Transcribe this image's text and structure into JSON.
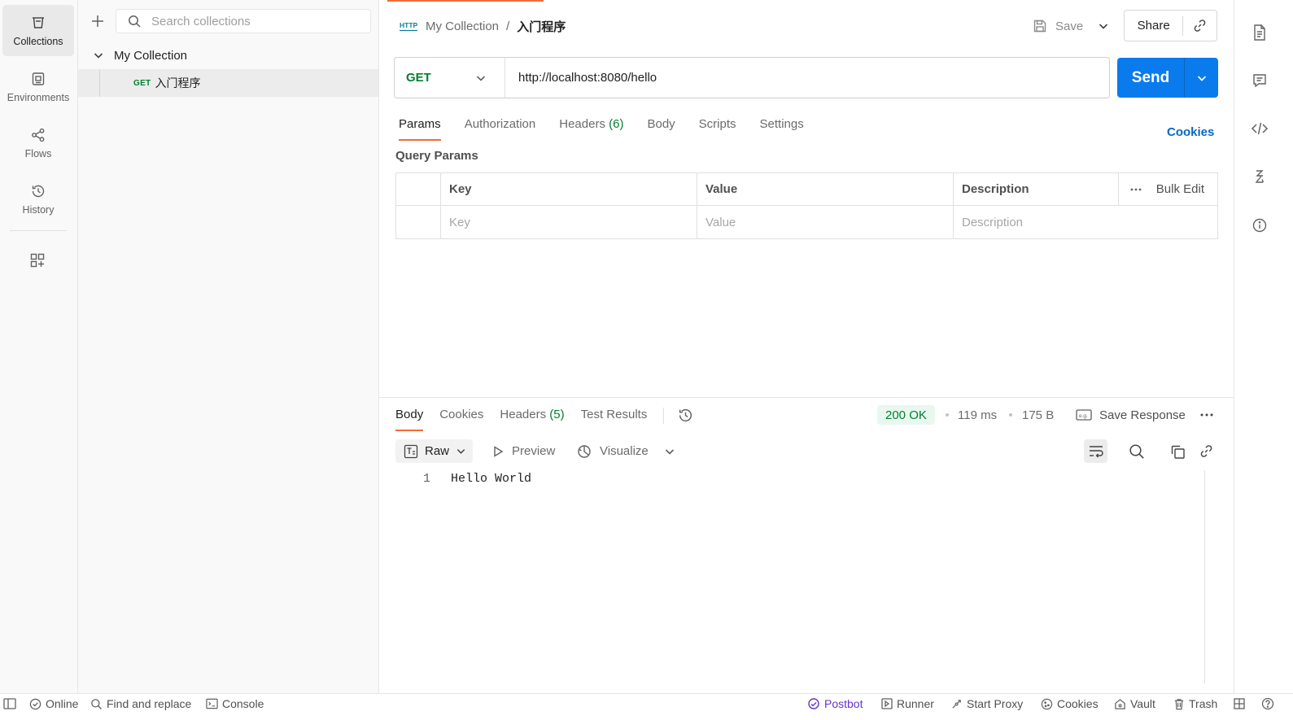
{
  "rail": {
    "items": [
      {
        "label": "Collections"
      },
      {
        "label": "Environments"
      },
      {
        "label": "Flows"
      },
      {
        "label": "History"
      }
    ]
  },
  "sidebar": {
    "search_placeholder": "Search collections",
    "collection_name": "My Collection",
    "request": {
      "method": "GET",
      "name": "入门程序"
    }
  },
  "header": {
    "http_badge": "HTTP",
    "crumb_collection": "My Collection",
    "crumb_sep": "/",
    "crumb_request": "入门程序",
    "save_label": "Save",
    "share_label": "Share"
  },
  "request": {
    "method": "GET",
    "url": "http://localhost:8080/hello",
    "send_label": "Send"
  },
  "request_tabs": {
    "params": "Params",
    "authorization": "Authorization",
    "headers": "Headers",
    "headers_count": "(6)",
    "body": "Body",
    "scripts": "Scripts",
    "settings": "Settings",
    "cookies": "Cookies"
  },
  "query_params": {
    "title": "Query Params",
    "headers": [
      "Key",
      "Value",
      "Description"
    ],
    "bulk_edit": "Bulk Edit",
    "placeholders": [
      "Key",
      "Value",
      "Description"
    ]
  },
  "response": {
    "tabs": {
      "body": "Body",
      "cookies": "Cookies",
      "headers": "Headers",
      "headers_count": "(5)",
      "test_results": "Test Results"
    },
    "status": "200 OK",
    "time": "119 ms",
    "size": "175 B",
    "save_response": "Save Response",
    "format": "Raw",
    "preview": "Preview",
    "visualize": "Visualize",
    "lines": [
      {
        "num": "1",
        "text": "Hello World"
      }
    ]
  },
  "statusbar": {
    "online": "Online",
    "find_replace": "Find and replace",
    "console": "Console",
    "postbot": "Postbot",
    "runner": "Runner",
    "start_proxy": "Start Proxy",
    "cookies": "Cookies",
    "vault": "Vault",
    "trash": "Trash"
  },
  "colors": {
    "accent": "#f26b3a",
    "send_blue": "#097bed",
    "method_green": "#007f31",
    "link_blue": "#0a66c2",
    "postbot_purple": "#6633cc"
  }
}
